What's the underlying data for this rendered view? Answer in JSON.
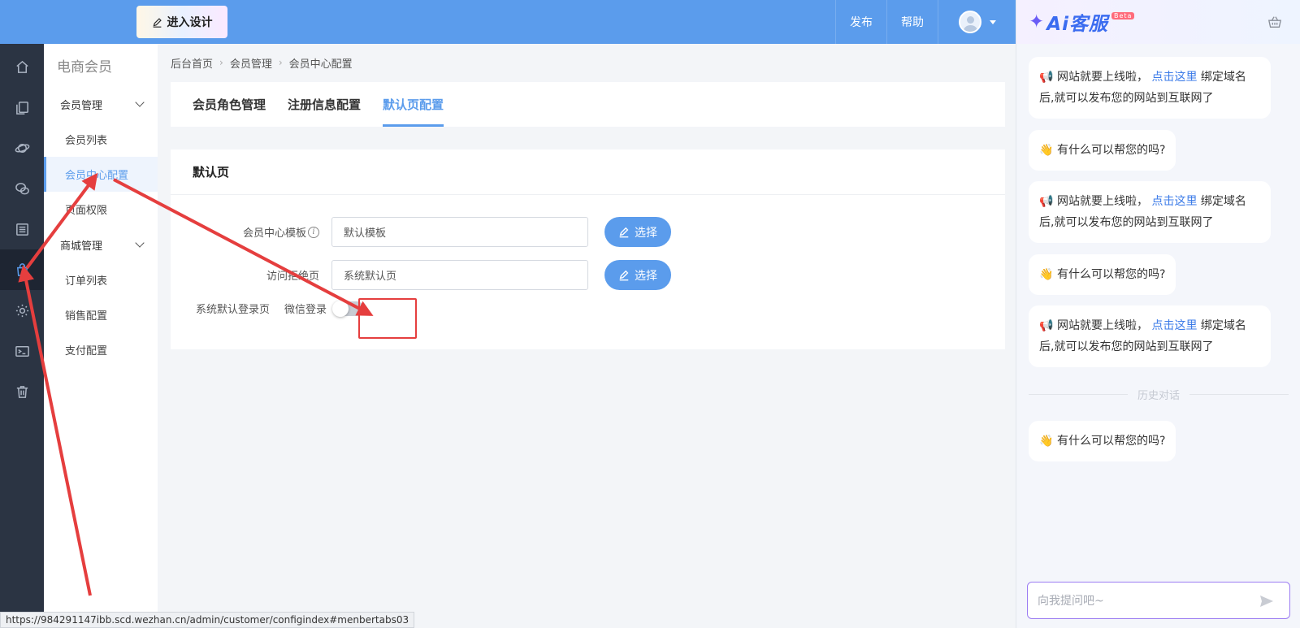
{
  "header": {
    "design_label": "进入设计",
    "publish_label": "发布",
    "help_label": "帮助"
  },
  "sidebar": {
    "title": "电商会员",
    "groups": [
      {
        "label": "会员管理",
        "items": [
          "会员列表",
          "会员中心配置",
          "页面权限"
        ]
      },
      {
        "label": "商城管理",
        "items": [
          "订单列表",
          "销售配置",
          "支付配置"
        ]
      }
    ],
    "active_item": "会员中心配置"
  },
  "breadcrumb": [
    "后台首页",
    "会员管理",
    "会员中心配置"
  ],
  "tabs": [
    "会员角色管理",
    "注册信息配置",
    "默认页配置"
  ],
  "active_tab": "默认页配置",
  "form": {
    "section_title": "默认页",
    "template_label": "会员中心模板",
    "template_value": "默认模板",
    "deny_label": "访问拒绝页",
    "deny_value": "系统默认页",
    "choose_label": "选择",
    "login_label": "系统默认登录页",
    "wechat_label": "微信登录",
    "wechat_enabled": false
  },
  "status_url": "https://984291147ibb.scd.wezhan.cn/admin/customer/configindex#menbertabs03",
  "ai_panel": {
    "logo": "Ai客服",
    "beta": "Beta",
    "messages": [
      {
        "type": "notice",
        "text_before": "网站就要上线啦，",
        "link": "点击这里",
        "text_after": "绑定域名后,就可以发布您的网站到互联网了"
      },
      {
        "type": "greet",
        "text": "有什么可以帮您的吗?"
      },
      {
        "type": "notice",
        "text_before": "网站就要上线啦，",
        "link": "点击这里",
        "text_after": "绑定域名后,就可以发布您的网站到互联网了"
      },
      {
        "type": "greet",
        "text": "有什么可以帮您的吗?"
      },
      {
        "type": "notice",
        "text_before": "网站就要上线啦，",
        "link": "点击这里",
        "text_after": "绑定域名后,就可以发布您的网站到互联网了"
      }
    ],
    "history_label": "历史对话",
    "history_message": "有什么可以帮您的吗?",
    "input_placeholder": "向我提问吧~"
  },
  "colors": {
    "primary": "#5b9cec",
    "rail_bg": "#2b3443",
    "annotation": "#e53e3e",
    "link": "#3b7be8"
  }
}
